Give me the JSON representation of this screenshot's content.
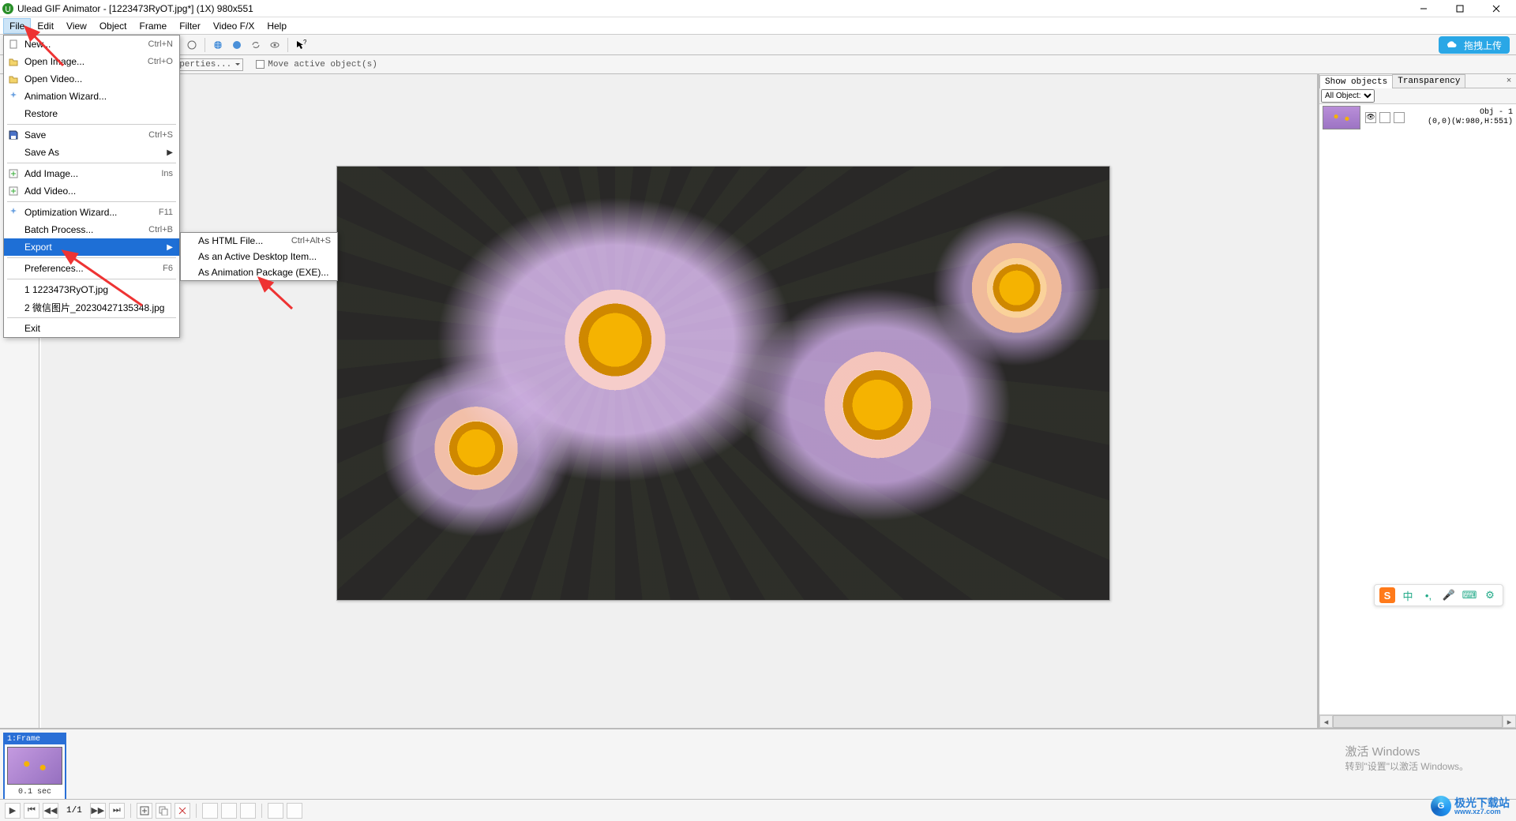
{
  "titlebar": {
    "title": "Ulead GIF Animator - [1223473RyOT.jpg*] (1X) 980x551"
  },
  "menus": [
    "File",
    "Edit",
    "View",
    "Object",
    "Frame",
    "Filter",
    "Video F/X",
    "Help"
  ],
  "cloud_button": "拖拽上传",
  "optbar": {
    "properties_btn": "roperties...",
    "move_active": "Move active object(s)"
  },
  "file_menu": {
    "items": [
      {
        "icon": "new-icon",
        "label": "New...",
        "accel": "Ctrl+N"
      },
      {
        "icon": "open-image-icon",
        "label": "Open Image...",
        "accel": "Ctrl+O"
      },
      {
        "icon": "open-video-icon",
        "label": "Open Video...",
        "accel": ""
      },
      {
        "icon": "wizard-icon",
        "label": "Animation Wizard...",
        "accel": ""
      },
      {
        "icon": "",
        "label": "Restore",
        "accel": ""
      },
      {
        "sep": true
      },
      {
        "icon": "save-icon",
        "label": "Save",
        "accel": "Ctrl+S"
      },
      {
        "icon": "",
        "label": "Save As",
        "accel": "",
        "submenu": true
      },
      {
        "sep": true
      },
      {
        "icon": "add-image-icon",
        "label": "Add Image...",
        "accel": "Ins"
      },
      {
        "icon": "add-video-icon",
        "label": "Add Video...",
        "accel": ""
      },
      {
        "sep": true
      },
      {
        "icon": "optimize-icon",
        "label": "Optimization Wizard...",
        "accel": "F11"
      },
      {
        "icon": "",
        "label": "Batch Process...",
        "accel": "Ctrl+B"
      },
      {
        "icon": "",
        "label": "Export",
        "accel": "",
        "submenu": true,
        "highlight": true
      },
      {
        "sep": true
      },
      {
        "icon": "",
        "label": "Preferences...",
        "accel": "F6"
      },
      {
        "sep": true
      },
      {
        "icon": "",
        "label": "1 1223473RyOT.jpg",
        "accel": ""
      },
      {
        "icon": "",
        "label": "2 微信图片_20230427135348.jpg",
        "accel": ""
      },
      {
        "sep": true
      },
      {
        "icon": "",
        "label": "Exit",
        "accel": ""
      }
    ]
  },
  "export_submenu": [
    {
      "label": "As HTML File...",
      "accel": "Ctrl+Alt+S"
    },
    {
      "label": "As an Active Desktop Item...",
      "accel": ""
    },
    {
      "label": "As Animation Package (EXE)...",
      "accel": ""
    }
  ],
  "rpanel": {
    "tab1": "Show objects",
    "tab2": "Transparency",
    "filter": "All Object:",
    "obj_name": "Obj - 1",
    "obj_coords": "(0,0)(W:980,H:551)"
  },
  "frame": {
    "header": "1:Frame",
    "duration": "0.1 sec"
  },
  "playbar": {
    "counter": "1/1"
  },
  "watermark_win": {
    "line1": "激活 Windows",
    "line2": "转到\"设置\"以激活 Windows。"
  },
  "watermark_site": {
    "name": "极光下载站",
    "url": "www.xz7.com"
  },
  "ime_label": "中"
}
